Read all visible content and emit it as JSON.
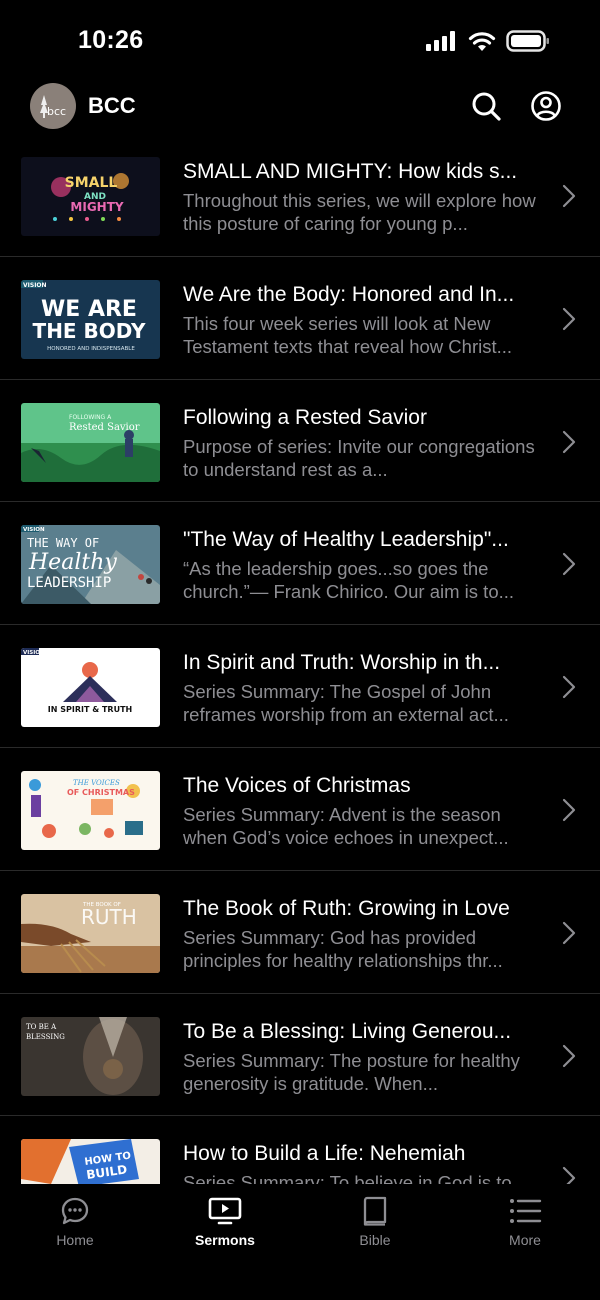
{
  "status": {
    "time": "10:26"
  },
  "header": {
    "title": "BCC",
    "logo_text": "bcc"
  },
  "sermons": [
    {
      "title": "SMALL AND MIGHTY: How kids s...",
      "description": "Throughout this series, we will explore how this posture of caring for young p..."
    },
    {
      "title": "We Are the Body: Honored and In...",
      "description": "This four week series will look at New Testament texts that reveal how Christ..."
    },
    {
      "title": "Following a Rested Savior",
      "description": "Purpose of series: Invite our congregations to understand rest as a..."
    },
    {
      "title": "\"The Way of Healthy Leadership\"...",
      "description": "“As the leadership goes...so goes the church.”— Frank Chirico. Our aim is to..."
    },
    {
      "title": "In Spirit and Truth: Worship in th...",
      "description": "Series Summary: The Gospel of John reframes worship from an external act..."
    },
    {
      "title": "The Voices of Christmas",
      "description": "Series Summary: Advent is the season when God’s voice echoes in unexpect..."
    },
    {
      "title": "The Book of Ruth: Growing in Love",
      "description": "Series Summary: God has provided principles for healthy relationships thr..."
    },
    {
      "title": "To Be a Blessing: Living Generou...",
      "description": "Series Summary: The posture for healthy generosity is gratitude. When..."
    },
    {
      "title": "How to Build a Life: Nehemiah",
      "description": "Series Summary: To believe in God is to..."
    }
  ],
  "thumb_text": {
    "small_mighty": [
      "SMALL",
      "AND",
      "MIGHTY"
    ],
    "body": [
      "VISION",
      "WE ARE",
      "THE BODY",
      "HONORED AND INDISPENSABLE"
    ],
    "rested": [
      "FOLLOWING A",
      "Rested Savior"
    ],
    "healthy": [
      "VISION",
      "THE WAY OF",
      "Healthy",
      "LEADERSHIP"
    ],
    "spirit": [
      "VISION",
      "IN SPIRIT & TRUTH"
    ],
    "voices": [
      "THE VOICES",
      "OF CHRISTMAS"
    ],
    "ruth": [
      "THE BOOK OF",
      "RUTH"
    ],
    "blessing": [
      "TO BE A",
      "BLESSING"
    ],
    "build": [
      "HOW TO",
      "BUILD"
    ]
  },
  "tabs": [
    {
      "label": "Home",
      "icon": "chat-bubble-icon",
      "active": false
    },
    {
      "label": "Sermons",
      "icon": "tv-play-icon",
      "active": true
    },
    {
      "label": "Bible",
      "icon": "book-icon",
      "active": false
    },
    {
      "label": "More",
      "icon": "list-icon",
      "active": false
    }
  ],
  "colors": {
    "background": "#000000",
    "secondary_text": "#8e8e93",
    "divider": "#2a2a2a"
  }
}
